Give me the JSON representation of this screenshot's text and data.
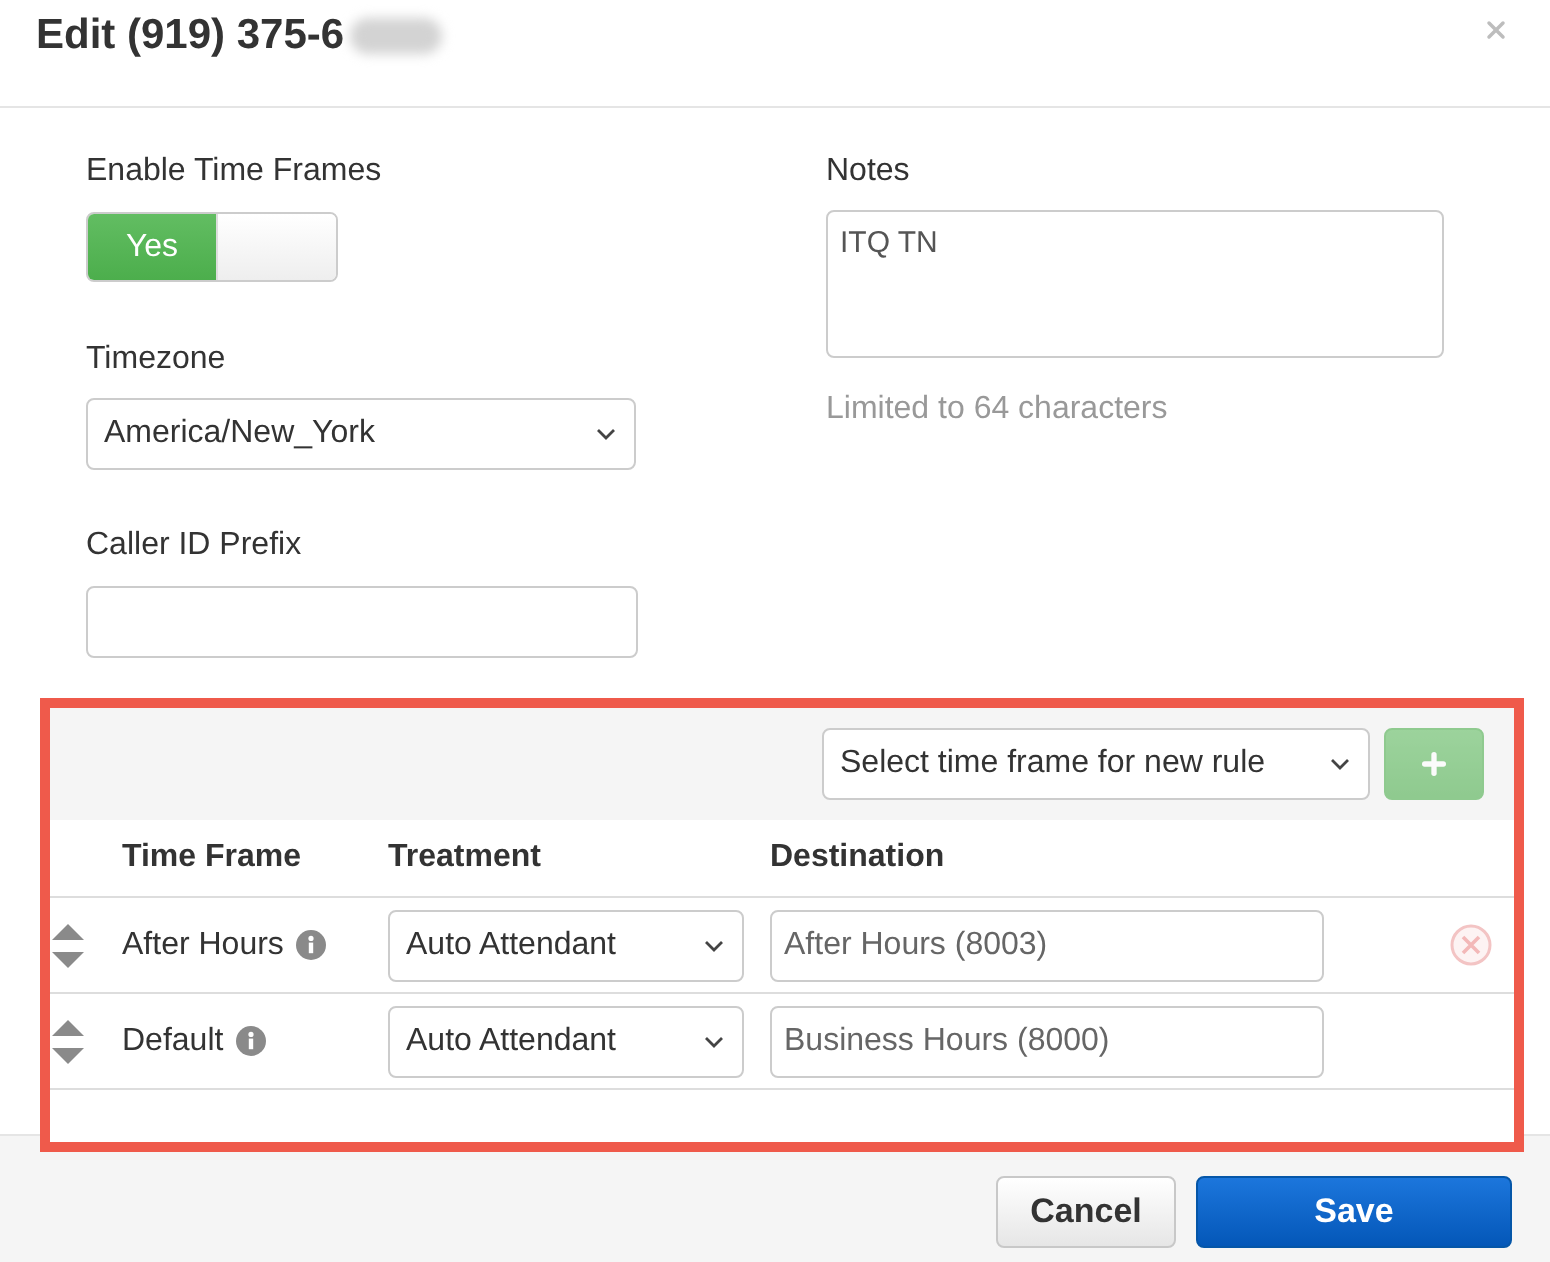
{
  "dialog": {
    "title": "Edit (919) 375-6"
  },
  "form": {
    "enable_time_frames": {
      "label": "Enable Time Frames",
      "on": true,
      "on_label": "Yes"
    },
    "timezone": {
      "label": "Timezone",
      "value": "America/New_York"
    },
    "caller_id_prefix": {
      "label": "Caller ID Prefix"
    },
    "notes": {
      "label": "Notes",
      "value": "ITQ TN",
      "help": "Limited to 64 characters"
    }
  },
  "rules": {
    "new_rule_select": {
      "value": "Select time frame for new rule"
    },
    "add_button": {
      "disabled": true
    },
    "columns": [
      "Time Frame",
      "Treatment",
      "Destination"
    ],
    "rows": [
      {
        "time_frame": "After Hours",
        "treatment": "Auto Attendant",
        "destination": "After Hours (8003)",
        "deletable": true
      },
      {
        "time_frame": "Default",
        "treatment": "Auto Attendant",
        "destination": "Business Hours (8000)",
        "deletable": false
      }
    ]
  },
  "footer": {
    "buttons": [
      {
        "label": "Cancel",
        "kind": "secondary"
      },
      {
        "label": "Save",
        "kind": "primary"
      }
    ]
  }
}
